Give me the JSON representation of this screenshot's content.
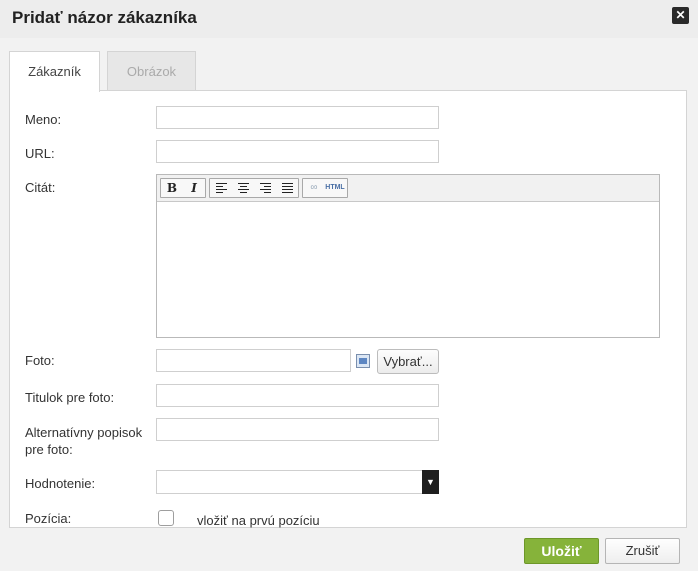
{
  "dialog": {
    "title": "Pridať názor zákazníka",
    "close_icon": "close-icon"
  },
  "tabs": [
    {
      "label": "Zákazník",
      "active": true
    },
    {
      "label": "Obrázok",
      "active": false
    }
  ],
  "form": {
    "name_label": "Meno:",
    "name_value": "",
    "url_label": "URL:",
    "url_value": "",
    "quote_label": "Citát:",
    "quote_value": "",
    "editor_toolbar": [
      "bold",
      "italic",
      "align-left",
      "align-center",
      "align-right",
      "align-justify",
      "link",
      "html"
    ],
    "bold_glyph": "B",
    "italic_glyph": "I",
    "html_label": "HTML",
    "photo_label": "Foto:",
    "photo_value": "",
    "choose_button": "Vybrať...",
    "photo_title_label": "Titulok pre foto:",
    "photo_title_value": "",
    "alt_label": "Alternatívny popisok pre foto:",
    "alt_value": "",
    "rating_label": "Hodnotenie:",
    "rating_value": "",
    "position_label": "Pozícia:",
    "position_checkbox_label": "vložiť na prvú pozíciu",
    "position_checked": false
  },
  "buttons": {
    "save": "Uložiť",
    "cancel": "Zrušiť"
  },
  "colors": {
    "save_bg": "#86b33a",
    "panel_border": "#d4d4d4"
  }
}
